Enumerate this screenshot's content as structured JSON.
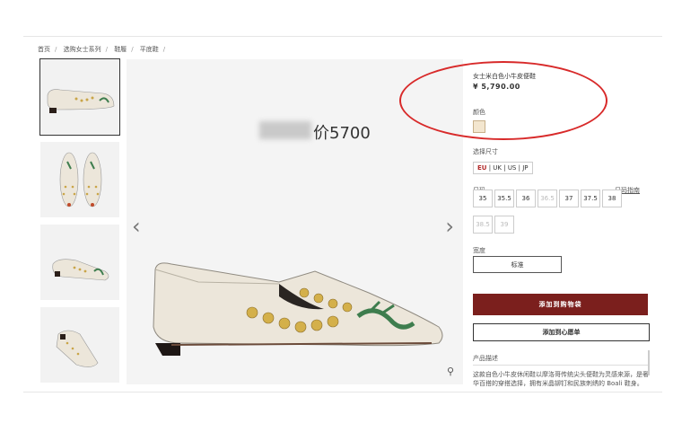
{
  "breadcrumb": [
    "首页",
    "选购女士系列",
    "鞋履",
    "平底鞋"
  ],
  "promo_text": "价5700",
  "product": {
    "title": "女士米白色小牛皮便鞋",
    "price": "¥ 5,790.00",
    "color_label": "颜色",
    "size_system_label": "选择尺寸",
    "size_systems": [
      "EU",
      "UK",
      "US",
      "JP"
    ],
    "size_label": "尺码",
    "size_guide": "尺码指南",
    "sizes": [
      {
        "value": "35",
        "available": true
      },
      {
        "value": "35.5",
        "available": true
      },
      {
        "value": "36",
        "available": true
      },
      {
        "value": "36.5",
        "available": false
      },
      {
        "value": "37",
        "available": true
      },
      {
        "value": "37.5",
        "available": true
      },
      {
        "value": "38",
        "available": true
      },
      {
        "value": "38.5",
        "available": false
      },
      {
        "value": "39",
        "available": false
      }
    ],
    "width_label": "宽度",
    "width_value": "标准",
    "add_to_cart": "添加到购物袋",
    "add_to_wishlist": "添加到心愿单",
    "description_label": "产品描述",
    "description": "这款自色小牛皮休闲鞋以摩洛哥传统尖头便鞋为灵感来源，是奢华百搭的穿搭选择，拥有米晶铆钉和民族刺绣的 Boali 鞋身。"
  },
  "colors": {
    "cart_bg": "#7b1f1d",
    "annotation": "#d82a2a"
  },
  "icons": {
    "prev": "chevron-left-icon",
    "next": "chevron-right-icon",
    "zoom": "zoom-icon"
  }
}
